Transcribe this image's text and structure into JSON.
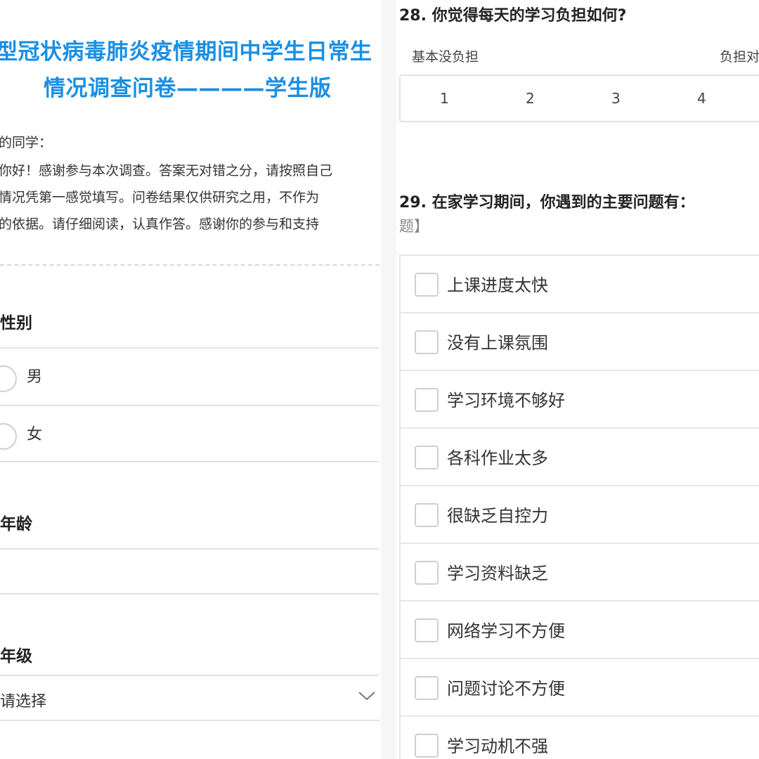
{
  "left": {
    "title_line1": "型冠状病毒肺炎疫情期间中学生日常生",
    "title_line2": "情况调查问卷————学生版",
    "intro": [
      "的同学：",
      "你好！感谢参与本次调查。答案无对错之分，请按照自己",
      "情况凭第一感觉填写。问卷结果仅供研究之用，不作为",
      "的依据。请仔细阅读，认真作答。感谢你的参与和支持"
    ],
    "gender": {
      "label": "性别",
      "options": [
        "男",
        "女"
      ]
    },
    "age": {
      "label": "年龄",
      "value": ""
    },
    "grade": {
      "label": "年级",
      "placeholder": "请选择"
    }
  },
  "right": {
    "required_mark": "*",
    "q28": {
      "label": "28. 你觉得每天的学习负担如何?",
      "scale_min_label": "基本没负担",
      "scale_max_label": "负担对",
      "scale": [
        "1",
        "2",
        "3",
        "4"
      ]
    },
    "q29": {
      "label": "29. 在家学习期间，你遇到的主要问题有：",
      "note": "题】",
      "options": [
        "上课进度太快",
        "没有上课氛围",
        "学习环境不够好",
        "各科作业太多",
        "很缺乏自控力",
        "学习资料缺乏",
        "网络学习不方便",
        "问题讨论不方便",
        "学习动机不强"
      ]
    }
  },
  "colors": {
    "title_blue": "#1a8fe3",
    "required_red": "#e0302b",
    "border": "#e3e3e3"
  }
}
